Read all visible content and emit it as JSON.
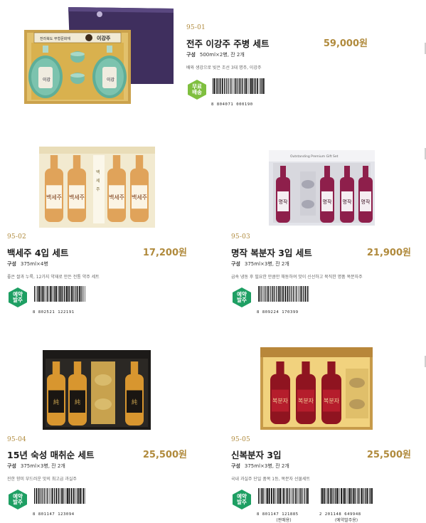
{
  "products": [
    {
      "code": "95-01",
      "name": "전주 이강주 주병 세트",
      "price": "59,000원",
      "spec_label": "구성",
      "spec_value": "500ml×2병, 잔 2개",
      "description": "배와 생강으로 빚은 조선 3대 명주, 이강주",
      "badge": [
        "무료",
        "배송"
      ],
      "badge_color": "#7fbf3f",
      "barcodes": [
        {
          "number": "8 804071 000190",
          "caption": ""
        }
      ]
    },
    {
      "code": "95-02",
      "name": "백세주 4입 세트",
      "price": "17,200원",
      "spec_label": "구성",
      "spec_value": "375ml×4병",
      "description": "좋은 쌀과 누룩, 12가지 약재로 만든 전통 약주 세트",
      "badge": [
        "예약",
        "발주"
      ],
      "badge_color": "#1e9f63",
      "barcodes": [
        {
          "number": "8 802521 122191",
          "caption": ""
        }
      ]
    },
    {
      "code": "95-03",
      "name": "명작 복분자 3입 세트",
      "price": "21,900원",
      "spec_label": "구성",
      "spec_value": "375ml×3병, 잔 2개",
      "description": "급속 냉동 후 필요한 만큼만 해동하여 맛이 신선하고 묵직한 명품 복분자주",
      "badge": [
        "예약",
        "발주"
      ],
      "badge_color": "#1e9f63",
      "barcodes": [
        {
          "number": "8 809224 170399",
          "caption": ""
        }
      ]
    },
    {
      "code": "95-04",
      "name": "15년 숙성 매취순 세트",
      "price": "25,500원",
      "spec_label": "구성",
      "spec_value": "375ml×3병, 잔 2개",
      "description": "진한 향미 부드러운 맛의 최고급 과실주",
      "badge": [
        "예약",
        "발주"
      ],
      "badge_color": "#1e9f63",
      "barcodes": [
        {
          "number": "8 801147 123094",
          "caption": ""
        }
      ]
    },
    {
      "code": "95-05",
      "name": "신복분자 3입",
      "price": "25,500원",
      "spec_label": "구성",
      "spec_value": "375ml×3병, 잔 2개",
      "description": "국내 과실주 단일 품목 1등, 복분자 선물세트",
      "badge": [
        "예약",
        "발주"
      ],
      "badge_color": "#1e9f63",
      "barcodes": [
        {
          "number": "8 801147 121885",
          "caption": "(판매용)"
        },
        {
          "number": "2 201148 649948",
          "caption": "(예약발주용)"
        }
      ]
    }
  ],
  "images": {
    "p1_box_label": "이강주",
    "p1_box_small": "전라북도 무형문화재",
    "p2_label": "백세주",
    "p3_label": "명작",
    "p3_box_text": "Outstanding Premium Gift Set",
    "p4_label": "純",
    "p5_label": "복분자"
  }
}
